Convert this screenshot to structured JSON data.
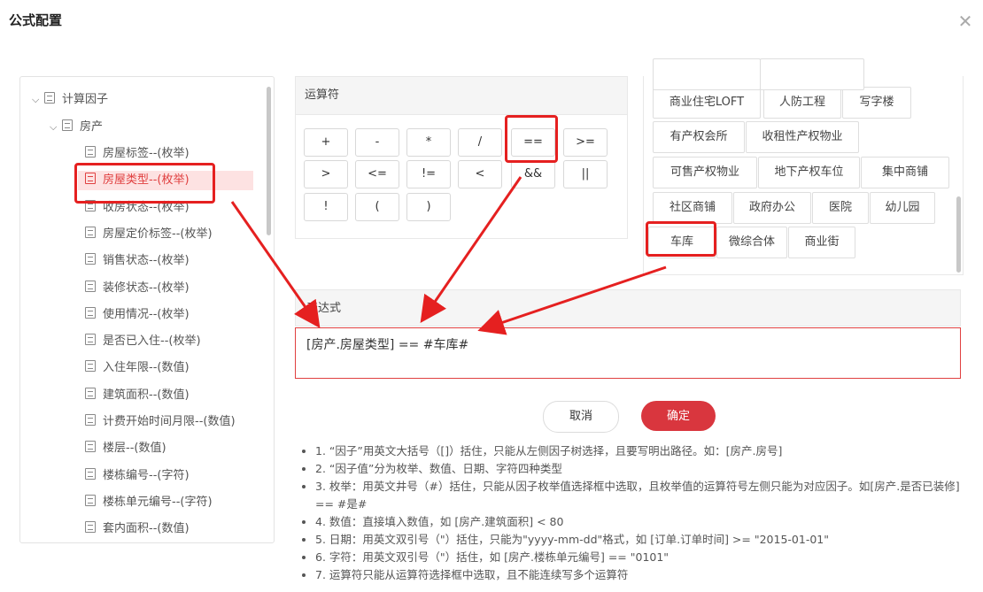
{
  "dialog": {
    "title": "公式配置"
  },
  "tree": {
    "root": "计算因子",
    "group": "房产",
    "items": [
      "房屋标签--(枚举)",
      "房屋类型--(枚举)",
      "收房状态--(枚举)",
      "房屋定价标签--(枚举)",
      "销售状态--(枚举)",
      "装修状态--(枚举)",
      "使用情况--(枚举)",
      "是否已入住--(枚举)",
      "入住年限--(数值)",
      "建筑面积--(数值)",
      "计费开始时间月限--(数值)",
      "楼层--(数值)",
      "楼栋编号--(字符)",
      "楼栋单元编号--(字符)",
      "套内面积--(数值)"
    ],
    "selected_index": 1
  },
  "operators": {
    "title": "运算符",
    "items": [
      "+",
      "-",
      "*",
      "/",
      "==",
      ">=",
      ">",
      "<=",
      "!=",
      "<",
      "&&",
      "||",
      "!",
      "(",
      ")"
    ]
  },
  "values": {
    "items": [
      "商业住宅LOFT",
      "人防工程",
      "写字楼",
      "有产权会所",
      "收租性产权物业",
      "可售产权物业",
      "地下产权车位",
      "集中商铺",
      "社区商铺",
      "政府办公",
      "医院",
      "幼儿园",
      "车库",
      "微综合体",
      "商业街"
    ]
  },
  "expression": {
    "title": "表达式",
    "value": "[房产.房屋类型] == #车库#"
  },
  "buttons": {
    "cancel": "取消",
    "ok": "确定"
  },
  "notes": [
    "1. “因子”用英文大括号（[]）括住，只能从左侧因子树选择，且要写明出路径。如：[房产.房号]",
    "2. “因子值”分为枚举、数值、日期、字符四种类型",
    "3. 枚举：用英文井号（#）括住，只能从因子枚举值选择框中选取，且枚举值的运算符号左侧只能为对应因子。如[房产.是否已装修] == #是#",
    "4. 数值：直接填入数值，如 [房产.建筑面积] < 80",
    "5. 日期：用英文双引号（\"）括住，只能为\"yyyy-mm-dd\"格式，如 [订单.订单时间] >= \"2015-01-01\"",
    "6. 字符：用英文双引号（\"）括住，如 [房产.楼栋单元编号] == \"0101\"",
    "7. 运算符只能从运算符选择框中选取，且不能连续写多个运算符"
  ],
  "colors": {
    "accent": "#d9363e",
    "highlight": "#e52020",
    "selected_bg": "#fde2e2"
  }
}
